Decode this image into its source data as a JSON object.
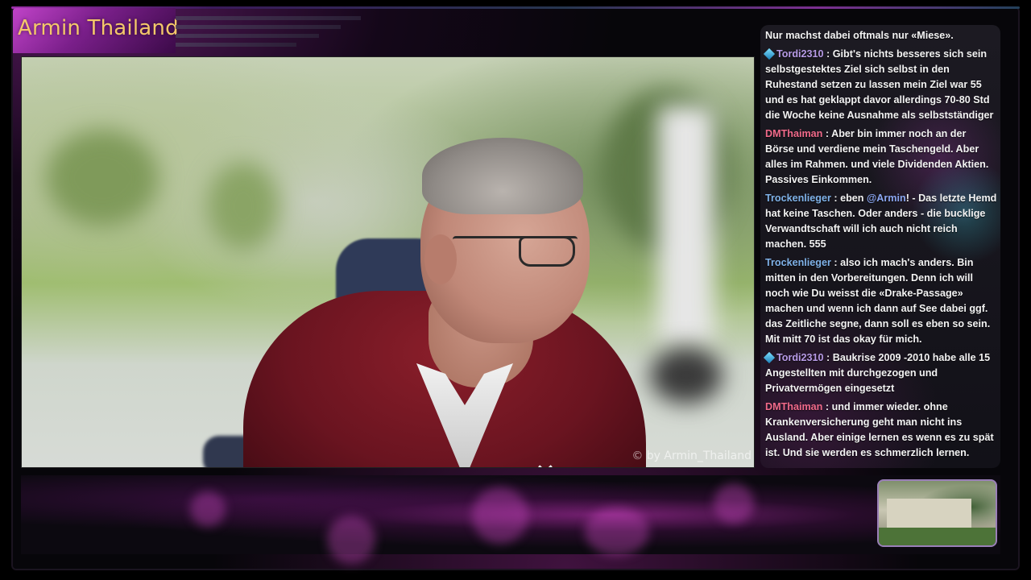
{
  "stream": {
    "title": "Armin Thailand",
    "watermark": "© by Armin_Thailand"
  },
  "colors": {
    "accent": "#c043c8",
    "title_text": "#f4c86a",
    "chat_bg": "#16151c"
  },
  "chat": {
    "messages": [
      {
        "user": "",
        "text": "Nur machst dabei oftmals nur «Miese».",
        "badge": ""
      },
      {
        "user": "Tordi2310",
        "sep": " : ",
        "text": "Gibt's nichts besseres sich sein selbstgestektes Ziel sich selbst in den Ruhestand setzen zu lassen mein Ziel war 55 und es hat geklappt davor allerdings 70-80 Std die Woche keine Ausnahme als selbstständiger",
        "badge": "gem-icon"
      },
      {
        "user": "DMThaiman",
        "sep": " : ",
        "text": "Aber bin immer noch an der Börse und verdiene mein Taschengeld. Aber alles im Rahmen. und viele Dividenden Aktien. Passives Einkommen.",
        "badge": ""
      },
      {
        "user": "Trockenlieger",
        "sep": " : ",
        "text_before": "eben ",
        "mention": "@Armin",
        "text": "! - Das letzte Hemd hat keine Taschen. Oder anders - die bucklige Verwandtschaft will ich auch nicht reich machen. 555",
        "badge": ""
      },
      {
        "user": "Trockenlieger",
        "sep": " : ",
        "text": "also ich mach's anders. Bin mitten in den Vorbereitungen. Denn ich will noch wie Du weisst die «Drake-Passage» machen und wenn ich dann auf See dabei ggf. das Zeitliche segne, dann soll es eben so sein. Mit mitt 70 ist das okay für mich.",
        "badge": ""
      },
      {
        "user": "Tordi2310",
        "sep": " : ",
        "text": "Baukrise 2009 -2010 habe alle 15 Angestellten mit durchgezogen und Privatvermögen eingesetzt",
        "badge": "gem-icon"
      },
      {
        "user": "DMThaiman",
        "sep": " : ",
        "text": "und immer wieder. ohne Krankenversicherung geht man nicht ins Ausland. Aber einige lernen es wenn es zu spät ist. Und sie werden es schmerzlich lernen.",
        "badge": ""
      }
    ]
  }
}
